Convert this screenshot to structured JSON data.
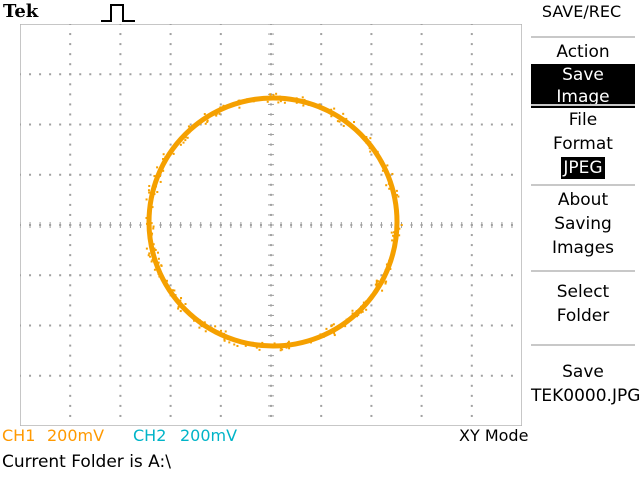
{
  "brand": "Tek",
  "trigger_icon": "square-pulse-icon",
  "menu": {
    "title": "SAVE/REC",
    "action": {
      "label": "Action",
      "value": "Save Image"
    },
    "file_format": {
      "label_line1": "File",
      "label_line2": "Format",
      "value": "JPEG"
    },
    "about": {
      "line1": "About",
      "line2": "Saving",
      "line3": "Images"
    },
    "select_folder": {
      "line1": "Select",
      "line2": "Folder"
    },
    "save": {
      "line1": "Save",
      "line2": "TEK0000.JPG"
    }
  },
  "status": {
    "ch1": {
      "label": "CH1",
      "value": "200mV",
      "color": "#ff9900"
    },
    "ch2": {
      "label": "CH2",
      "value": "200mV",
      "color": "#00b4c8"
    },
    "mode": "XY Mode"
  },
  "folder_text": "Current Folder is A:\\",
  "colors": {
    "trace": "#f5a000",
    "graticule_dots": "#a0a0a0",
    "highlight_bg": "#000000",
    "separator": "#c8c8c8"
  }
}
